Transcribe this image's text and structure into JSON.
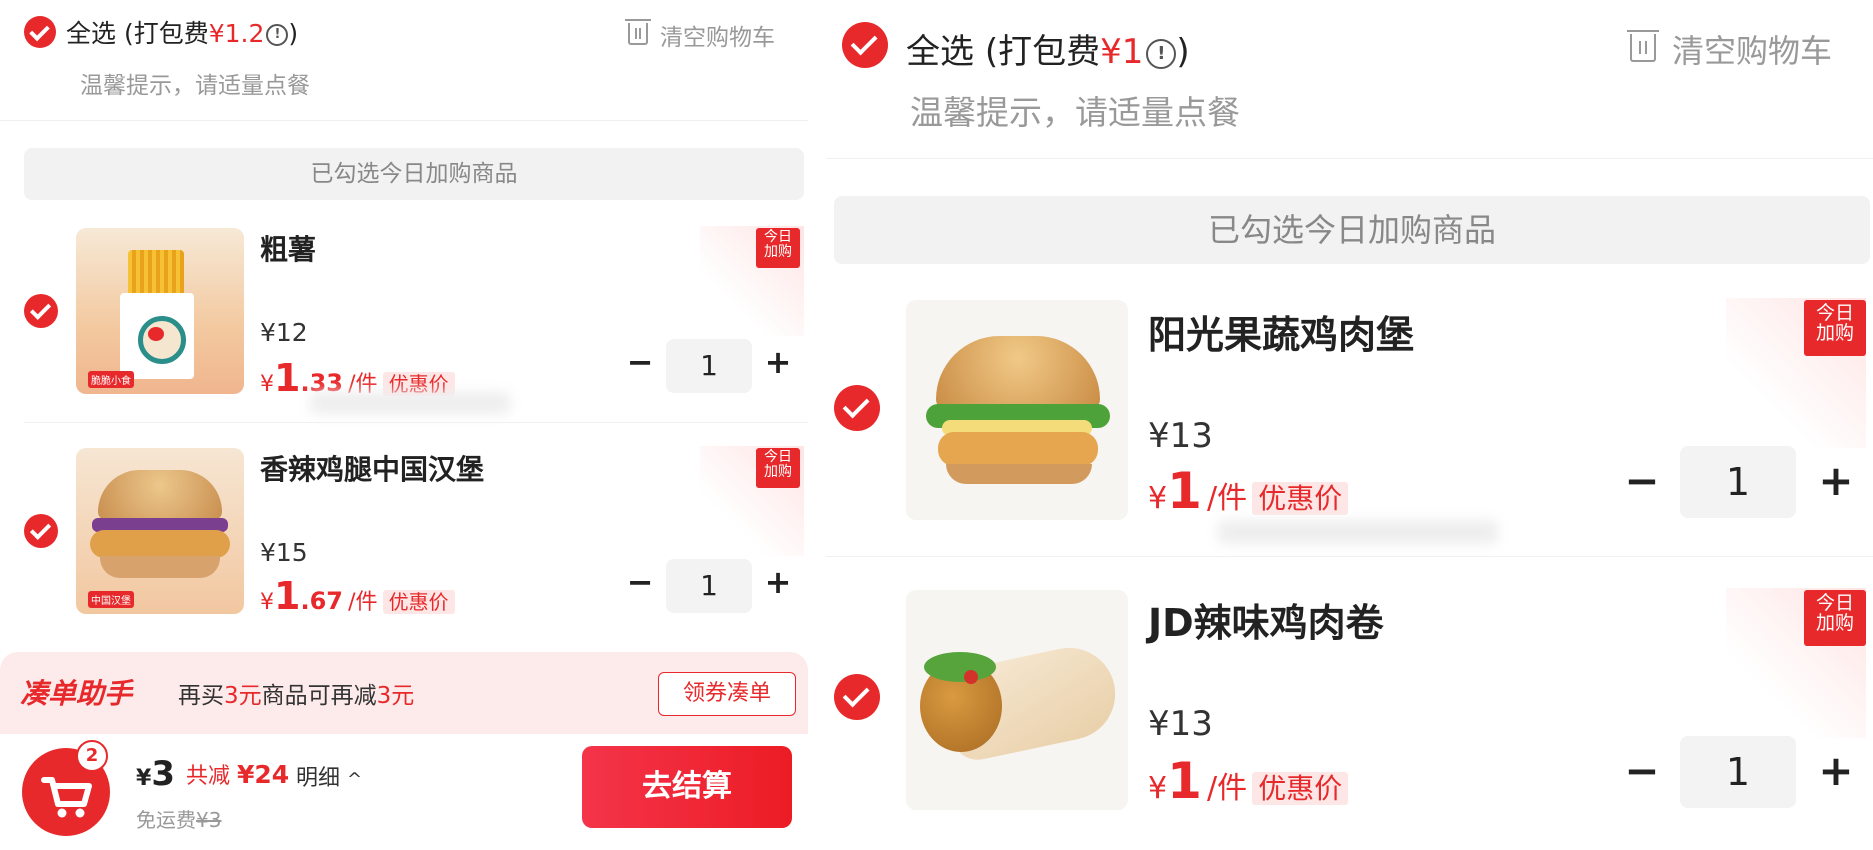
{
  "left": {
    "header": {
      "select_all": "全选",
      "packing_prefix": "(打包费",
      "packing_fee": "¥1.2",
      "info_glyph": "!",
      "close_paren": ")",
      "clear_cart": "清空购物车",
      "tip": "温馨提示，请适量点餐"
    },
    "section_banner": "已勾选今日加购商品",
    "items": [
      {
        "name": "粗薯",
        "price": "¥12",
        "yen": "¥",
        "promo_int": "1",
        "promo_dec": ".33",
        "per": "/件",
        "promo_label": "优惠价",
        "qty": "1",
        "tag1": "今日",
        "tag2": "加购",
        "img_label": "脆脆小食"
      },
      {
        "name": "香辣鸡腿中国汉堡",
        "price": "¥15",
        "yen": "¥",
        "promo_int": "1",
        "promo_dec": ".67",
        "per": "/件",
        "promo_label": "优惠价",
        "qty": "1",
        "tag1": "今日",
        "tag2": "加购",
        "img_label": "中国汉堡"
      }
    ],
    "helper": {
      "title": "凑单助手",
      "text_a": "再买",
      "amount1": "3元",
      "text_b": "商品可再减",
      "amount2": "3元",
      "button": "领券凑单"
    },
    "footer": {
      "cart_count": "2",
      "yen": "¥",
      "total": "3",
      "saved_label": "共减",
      "saved": "¥24",
      "detail": "明细",
      "detail_arrow": "^",
      "shipping_label": "免运费",
      "shipping_orig": "¥3",
      "checkout": "去结算"
    }
  },
  "right": {
    "header": {
      "select_all": "全选",
      "packing_prefix": "(打包费",
      "packing_fee": "¥1",
      "info_glyph": "!",
      "close_paren": ")",
      "clear_cart": "清空购物车",
      "tip": "温馨提示，请适量点餐"
    },
    "section_banner": "已勾选今日加购商品",
    "items": [
      {
        "name": "阳光果蔬鸡肉堡",
        "price": "¥13",
        "yen": "¥",
        "promo_int": "1",
        "promo_dec": "",
        "per": "/件",
        "promo_label": "优惠价",
        "qty": "1",
        "tag1": "今日",
        "tag2": "加购"
      },
      {
        "name": "JD辣味鸡肉卷",
        "price": "¥13",
        "yen": "¥",
        "promo_int": "1",
        "promo_dec": "",
        "per": "/件",
        "promo_label": "优惠价",
        "qty": "1",
        "tag1": "今日",
        "tag2": "加购"
      }
    ]
  },
  "symbols": {
    "minus": "−",
    "plus": "+"
  }
}
